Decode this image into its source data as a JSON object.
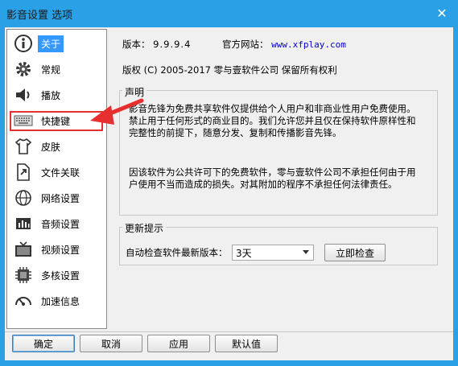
{
  "window": {
    "title": "影音设置 选项",
    "close_glyph": "✕"
  },
  "sidebar": {
    "items": [
      {
        "label": "关于",
        "icon": "info-icon",
        "active": true
      },
      {
        "label": "常规",
        "icon": "gear-icon"
      },
      {
        "label": "播放",
        "icon": "speaker-icon"
      },
      {
        "label": "快捷键",
        "icon": "keyboard-icon"
      },
      {
        "label": "皮肤",
        "icon": "shirt-icon"
      },
      {
        "label": "文件关联",
        "icon": "file-link-icon"
      },
      {
        "label": "网络设置",
        "icon": "globe-icon"
      },
      {
        "label": "音频设置",
        "icon": "audio-icon"
      },
      {
        "label": "视频设置",
        "icon": "tv-icon"
      },
      {
        "label": "多核设置",
        "icon": "chip-icon"
      },
      {
        "label": "加速信息",
        "icon": "speedometer-icon"
      }
    ]
  },
  "about": {
    "version_label": "版本：",
    "version_value": "9.9.9.4",
    "website_label": "官方网站：",
    "website_value": "www.xfplay.com",
    "copyright": "版权 (C) 2005-2017 零与壹软件公司 保留所有权利",
    "statement_title": "声明",
    "statement_p1_l1": "影音先锋为免费共享软件仅提供给个人用户和非商业性用户免费使用。",
    "statement_p1_l2": "禁止用于任何形式的商业目的。我们允许您并且仅在保持软件原样性和",
    "statement_p1_l3": "完整性的前提下，随意分发、复制和传播影音先锋。",
    "statement_p2_l1": "因该软件为公共许可下的免费软件，零与壹软件公司不承担任何由于用",
    "statement_p2_l2": "户使用不当而造成的损失。对其附加的程序不承担任何法律责任。",
    "update_title": "更新提示",
    "auto_check_label": "自动检查软件最新版本：",
    "auto_check_value": "3天",
    "check_now_label": "立即检查"
  },
  "footer": {
    "ok_label": "确定",
    "cancel_label": "取消",
    "apply_label": "应用",
    "default_label": "默认值"
  },
  "colors": {
    "accent": "#2aa1e6",
    "selection": "#3399ff",
    "annotation_red": "#e62f2f"
  }
}
